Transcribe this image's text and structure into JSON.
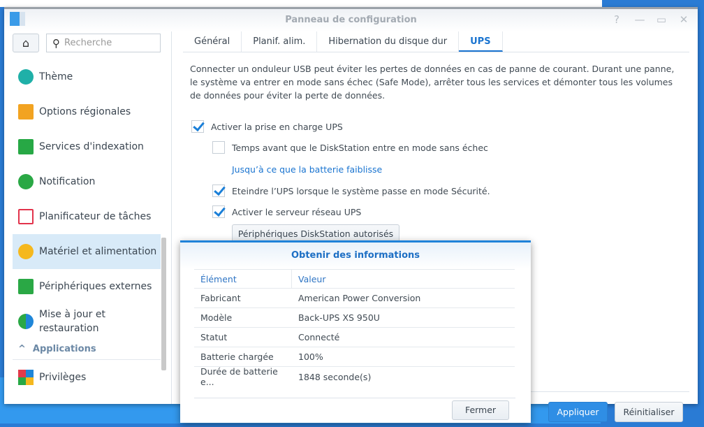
{
  "window": {
    "title": "Panneau de configuration"
  },
  "search": {
    "placeholder": "Recherche"
  },
  "sidebar": {
    "items": [
      {
        "label": "Thème",
        "color": "#1fb0a8"
      },
      {
        "label": "Options régionales",
        "color": "#f2a321"
      },
      {
        "label": "Services d'indexation",
        "color": "#27a845"
      },
      {
        "label": "Notification",
        "color": "#2aa845"
      },
      {
        "label": "Planificateur de tâches",
        "color": "#e2334b"
      },
      {
        "label": "Matériel et alimentation",
        "color": "#f5b81e"
      },
      {
        "label": "Périphériques externes",
        "color": "#2aa845"
      },
      {
        "label": "Mise à jour et",
        "label2": "restauration",
        "color": "#1f86d8"
      }
    ],
    "section": "Applications",
    "after": [
      {
        "label": "Privilèges",
        "color": "#e23a4b"
      }
    ]
  },
  "tabs": [
    "Général",
    "Planif. alim.",
    "Hibernation du disque dur",
    "UPS"
  ],
  "ups": {
    "description": "Connecter un onduleur USB peut éviter les pertes de données en cas de panne de courant. Durant une panne, le système va entrer en mode sans échec (Safe Mode), arrêter tous les services et démonter tous les volumes de données pour éviter la perte de données.",
    "enable": {
      "label": "Activer la prise en charge UPS",
      "checked": true
    },
    "safe_mode_time": {
      "label": "Temps avant que le DiskStation entre en mode sans échec",
      "checked": false
    },
    "safe_mode_link": "Jusqu’à ce que la batterie faiblisse",
    "shutdown": {
      "label": "Eteindre l’UPS lorsque le système passe en mode Sécurité.",
      "checked": true
    },
    "net_server": {
      "label": "Activer le serveur réseau UPS",
      "checked": true
    },
    "devices_button": "Périphériques DiskStation autorisés"
  },
  "footer": {
    "apply": "Appliquer",
    "reset": "Réinitialiser"
  },
  "dialog": {
    "title": "Obtenir des informations",
    "headers": [
      "Élément",
      "Valeur"
    ],
    "rows": [
      [
        "Fabricant",
        "American Power Conversion"
      ],
      [
        "Modèle",
        "Back-UPS XS 950U"
      ],
      [
        "Statut",
        "Connecté"
      ],
      [
        "Batterie chargée",
        "100%"
      ],
      [
        "Durée de batterie e...",
        "1848 seconde(s)"
      ]
    ],
    "close": "Fermer"
  }
}
